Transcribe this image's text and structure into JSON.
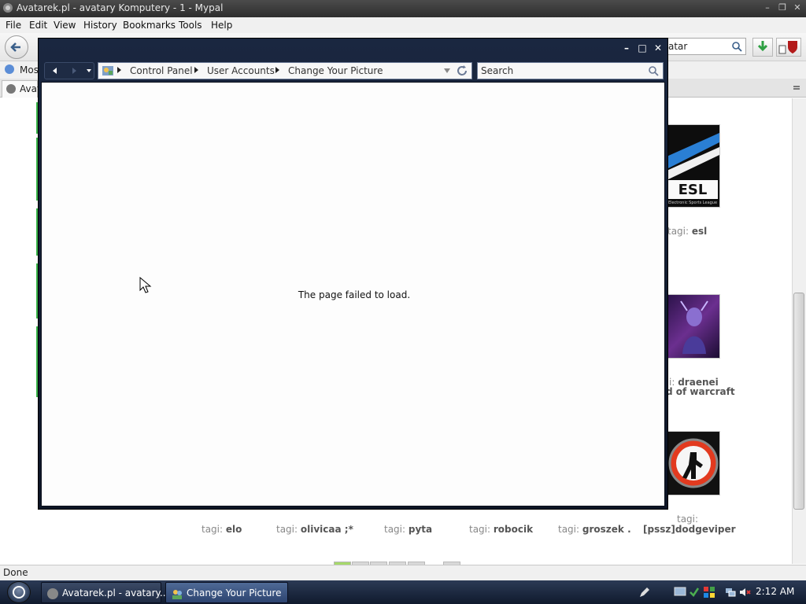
{
  "browser": {
    "title": "Avatarek.pl - avatary Komputery - 1 - Mypal",
    "menu": [
      "File",
      "Edit",
      "View",
      "History",
      "Bookmarks",
      "Tools",
      "Help"
    ],
    "url_fragment": "atar",
    "bookmark_fragment": "Mos",
    "tab_fragment": "Avat",
    "status": "Done"
  },
  "page": {
    "tags": [
      {
        "label": "tagi:",
        "value": "elo"
      },
      {
        "label": "tagi:",
        "value": "olivicaa ;*"
      },
      {
        "label": "tagi:",
        "value": "pyta"
      },
      {
        "label": "tagi:",
        "value": "robocik"
      },
      {
        "label": "tagi:",
        "value": "groszek ."
      },
      {
        "label": "tagi:",
        "value": "[pssz]dodgeviper"
      }
    ],
    "right_tags": [
      {
        "label": "tagi:",
        "value": "esl"
      },
      {
        "label": "i:",
        "value": "draenei"
      },
      {
        "label": "",
        "value": "d of warcraft"
      }
    ],
    "esl_logo_text": "ESL",
    "esl_logo_sub": "Electronic Sports League"
  },
  "explorer": {
    "breadcrumb": [
      "Control Panel",
      "User Accounts",
      "Change Your Picture"
    ],
    "search_placeholder": "Search",
    "message": "The page failed to load."
  },
  "taskbar": {
    "buttons": [
      "Avatarek.pl - avatary...",
      "Change Your Picture"
    ],
    "clock": "2:12 AM"
  },
  "colors": {
    "taskbar": "#1b263b",
    "explorer_frame": "#131d31",
    "green_accent": "#39b54a"
  }
}
